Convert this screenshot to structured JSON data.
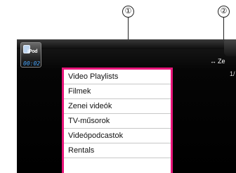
{
  "callouts": {
    "one": "①",
    "two": "②"
  },
  "source": {
    "label": "iPod",
    "time": "00:02"
  },
  "menu": {
    "items": [
      {
        "label": "Video Playlists"
      },
      {
        "label": "Filmek"
      },
      {
        "label": "Zenei videók"
      },
      {
        "label": "TV-műsorok"
      },
      {
        "label": "Videópodcastok"
      },
      {
        "label": "Rentals"
      }
    ]
  },
  "right_panel": {
    "shuffle_arrow": "↔",
    "shuffle_label": "Ze",
    "page": "1/"
  },
  "colors": {
    "highlight_border": "#e8157a",
    "time_text": "#4aa8ff"
  }
}
